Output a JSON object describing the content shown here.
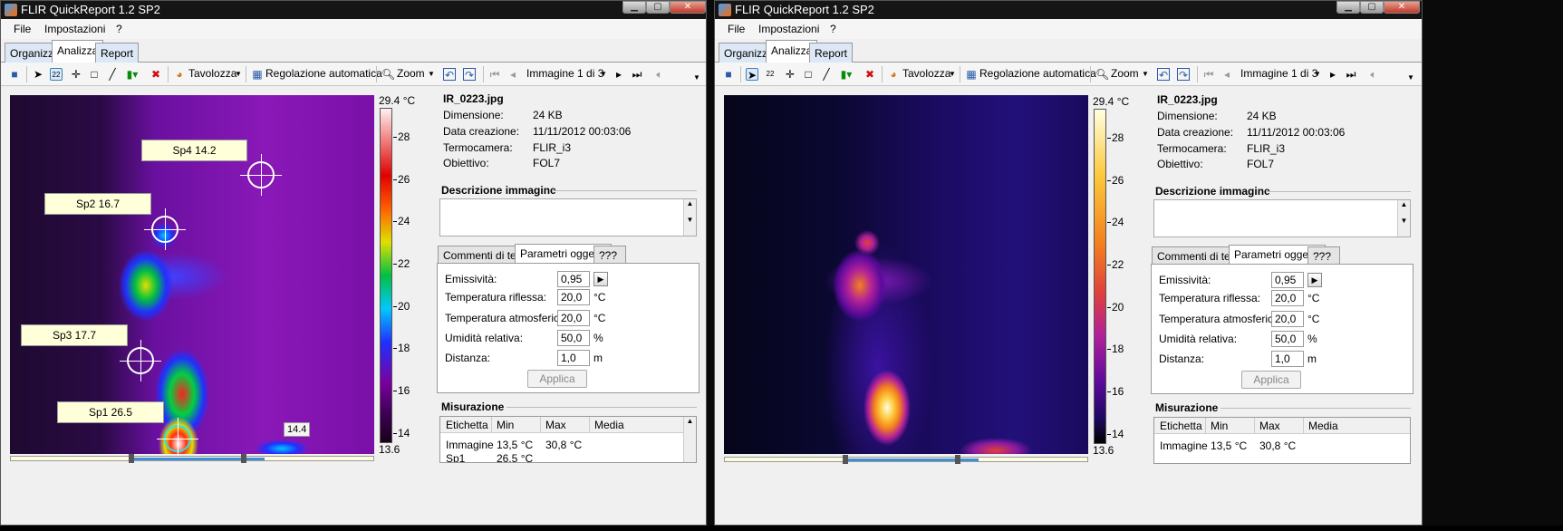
{
  "window_title": "FLIR QuickReport 1.2 SP2",
  "window_buttons": [
    "▁",
    "▢",
    "✕"
  ],
  "menu": [
    "File",
    "Impostazioni",
    "?"
  ],
  "main_tabs": [
    "Organizza",
    "Analizza",
    "Report"
  ],
  "toolbar": {
    "palette_label": "Tavolozza",
    "auto_adjust_label": "Regolazione automatica",
    "zoom_label": "Zoom",
    "image_nav_label": "Immagine 1 di 3"
  },
  "scale": {
    "max_label": "29.4 °C",
    "min_label": "13.6",
    "ticks": [
      "28",
      "26",
      "24",
      "22",
      "20",
      "18",
      "16",
      "14"
    ],
    "range": [
      13.6,
      29.4
    ]
  },
  "spots": [
    {
      "label": "Sp4 14.2"
    },
    {
      "label": "Sp2 16.7"
    },
    {
      "label": "Sp3 17.7"
    },
    {
      "label": "Sp1 26.5"
    }
  ],
  "hover_tooltip": "14.4",
  "file_info": {
    "filename": "IR_0223.jpg",
    "rows": [
      {
        "label": "Dimensione:",
        "value": "24 KB"
      },
      {
        "label": "Data creazione:",
        "value": "11/11/2012 00:03:06"
      },
      {
        "label": "Termocamera:",
        "value": "FLIR_i3"
      },
      {
        "label": "Obiettivo:",
        "value": "FOL7"
      }
    ]
  },
  "description_heading": "Descrizione immagine",
  "sub_tabs": [
    "Commenti di testo",
    "Parametri oggetto",
    "???"
  ],
  "params": [
    {
      "label": "Emissività:",
      "value": "0,95",
      "unit": ""
    },
    {
      "label": "Temperatura riflessa:",
      "value": "20,0",
      "unit": "°C"
    },
    {
      "label": "Temperatura atmosferica:",
      "value": "20,0",
      "unit": "°C"
    },
    {
      "label": "Umidità relativa:",
      "value": "50,0",
      "unit": "%"
    },
    {
      "label": "Distanza:",
      "value": "1,0",
      "unit": "m"
    }
  ],
  "apply_label": "Applica",
  "measurement": {
    "heading": "Misurazione",
    "columns": [
      "Etichetta",
      "Min",
      "Max",
      "Media"
    ],
    "rows": [
      {
        "label": "Immagine",
        "min": "13,5 °C",
        "max": "30,8 °C",
        "media": ""
      },
      {
        "label": "Sp1",
        "min": "26,5 °C",
        "max": "",
        "media": ""
      }
    ]
  },
  "colors": {
    "iron_palette": [
      "#000000",
      "#1a0a5c",
      "#5a0a9a",
      "#b0209a",
      "#e0403c",
      "#f4801e",
      "#fcc83a",
      "#ffffe0"
    ],
    "rainbow_palette": [
      "#1a001a",
      "#7a00a0",
      "#2030ff",
      "#00c8ff",
      "#00c040",
      "#e0e000",
      "#ff6000",
      "#e00000",
      "#fff0f0"
    ]
  }
}
